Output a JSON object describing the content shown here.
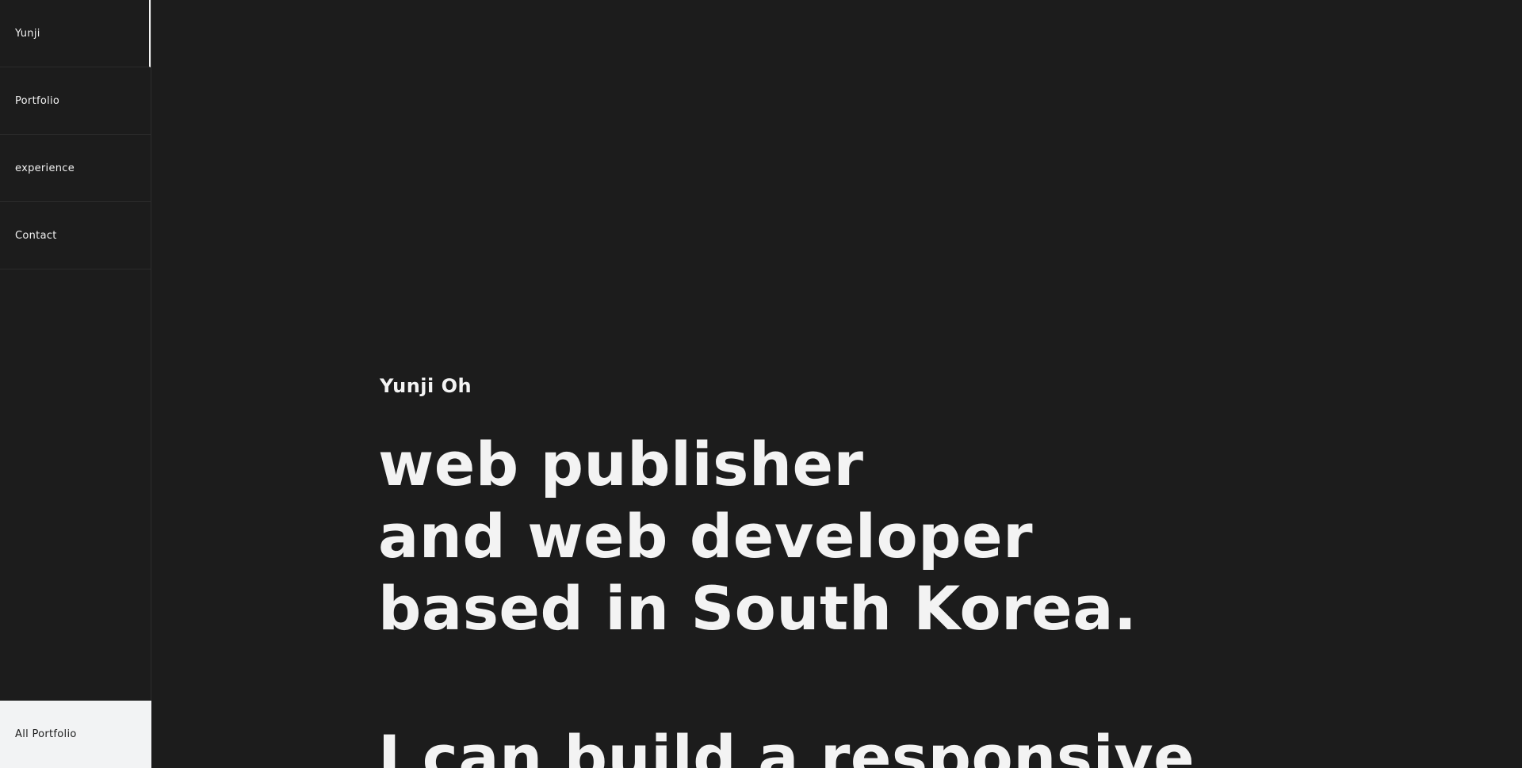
{
  "sidebar": {
    "items": [
      {
        "label": "Yunji",
        "active": true
      },
      {
        "label": "Portfolio",
        "active": false
      },
      {
        "label": "experience",
        "active": false
      },
      {
        "label": "Contact",
        "active": false
      }
    ],
    "footer_label": "All Portfolio"
  },
  "hero": {
    "name": "Yunji Oh",
    "headline_lines": [
      "web publisher",
      "and web developer",
      "based in South Korea."
    ],
    "subline": "I can build a responsive"
  },
  "colors": {
    "background": "#1c1c1c",
    "text": "#f3f3f3",
    "footer_bg": "#f2f3f4",
    "footer_text": "#1c1c1c"
  }
}
